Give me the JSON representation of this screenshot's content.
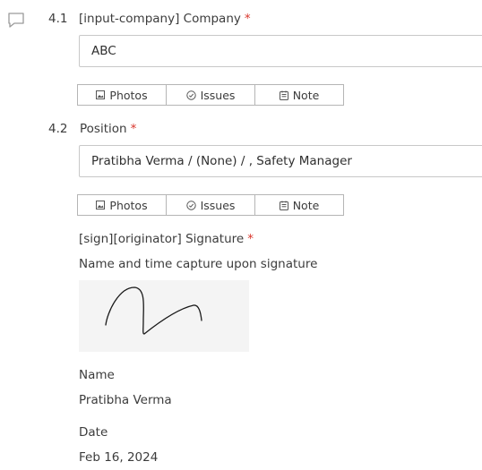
{
  "questions": [
    {
      "number": "4.1",
      "label": "[input-company] Company",
      "required_mark": "*",
      "value": "ABC"
    },
    {
      "number": "4.2",
      "label": "Position",
      "required_mark": "*",
      "value": "Pratibha Verma / (None) / , Safety Manager"
    }
  ],
  "actions": {
    "photos": "Photos",
    "issues": "Issues",
    "note": "Note"
  },
  "signature": {
    "label": "[sign][originator] Signature",
    "required_mark": "*",
    "hint": "Name and time capture upon signature",
    "name_label": "Name",
    "name_value": "Pratibha Verma",
    "date_label": "Date",
    "date_value": "Feb 16, 2024"
  },
  "icons": {
    "comment": "comment-icon",
    "photos": "image-icon",
    "issues": "check-circle-icon",
    "note": "note-icon"
  },
  "colors": {
    "required": "#d9352b",
    "border": "#c8c8c8",
    "signature_bg": "#f4f4f4"
  }
}
